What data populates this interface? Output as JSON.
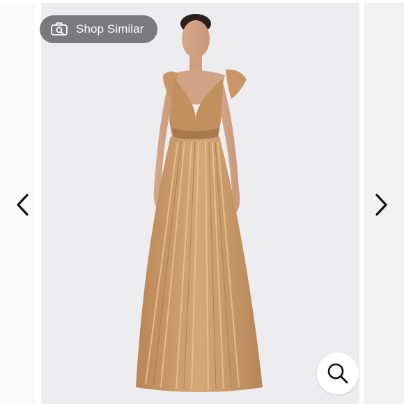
{
  "shop_similar": {
    "label": "Shop Similar",
    "icon": "camera-search-icon"
  },
  "navigation": {
    "prev_icon": "chevron-left-icon",
    "next_icon": "chevron-right-icon"
  },
  "zoom": {
    "icon": "magnifier-icon"
  },
  "colors": {
    "pill_bg": "#6d6d72",
    "slide_bg": "#ededef",
    "gown": "#c89a6a",
    "sequin": "#e8c089"
  }
}
